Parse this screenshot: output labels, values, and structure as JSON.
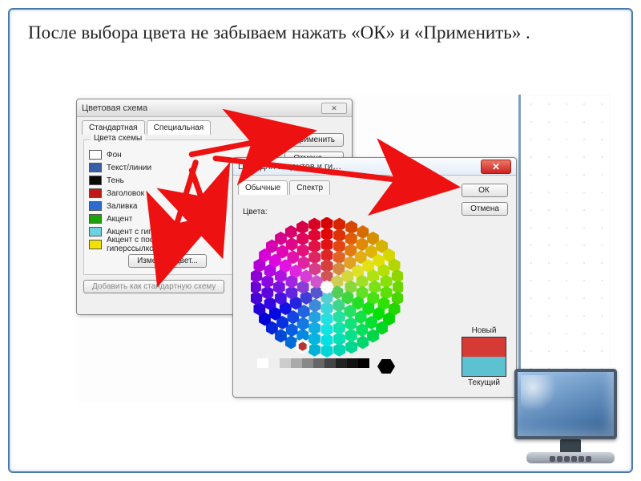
{
  "caption": "После выбора цвета не забываем нажать  «ОК» и «Применить» .",
  "dlg1": {
    "title": "Цветовая схема",
    "tabs": {
      "t1": "Стандартная",
      "t2": "Специальная"
    },
    "group_label": "Цвета схемы",
    "items": [
      {
        "label": "Фон",
        "color": "#ffffff"
      },
      {
        "label": "Текст/линии",
        "color": "#3a5fa8"
      },
      {
        "label": "Тень",
        "color": "#0a0a0a"
      },
      {
        "label": "Заголовок",
        "color": "#c01818"
      },
      {
        "label": "Заливка",
        "color": "#2d6bd0"
      },
      {
        "label": "Акцент",
        "color": "#1ea00a"
      },
      {
        "label": "Акцент с гиперссылкой",
        "color": "#6fd0df"
      },
      {
        "label": "Акцент с последующей гиперссылкой",
        "color": "#f2e200"
      }
    ],
    "change_color": "Изменить цвет...",
    "add_standard": "Добавить как стандартную схему",
    "buttons": {
      "apply": "Применить",
      "cancel": "Отмена"
    }
  },
  "dlg2": {
    "title": "Цвет для акцентов и ги…",
    "tabs": {
      "t1": "Обычные",
      "t2": "Спектр"
    },
    "colors_label": "Цвета:",
    "buttons": {
      "ok": "ОК",
      "cancel": "Отмена"
    },
    "new_label": "Новый",
    "current_label": "Текущий",
    "new_color": "#d63a34",
    "current_color": "#5cc2d1"
  }
}
